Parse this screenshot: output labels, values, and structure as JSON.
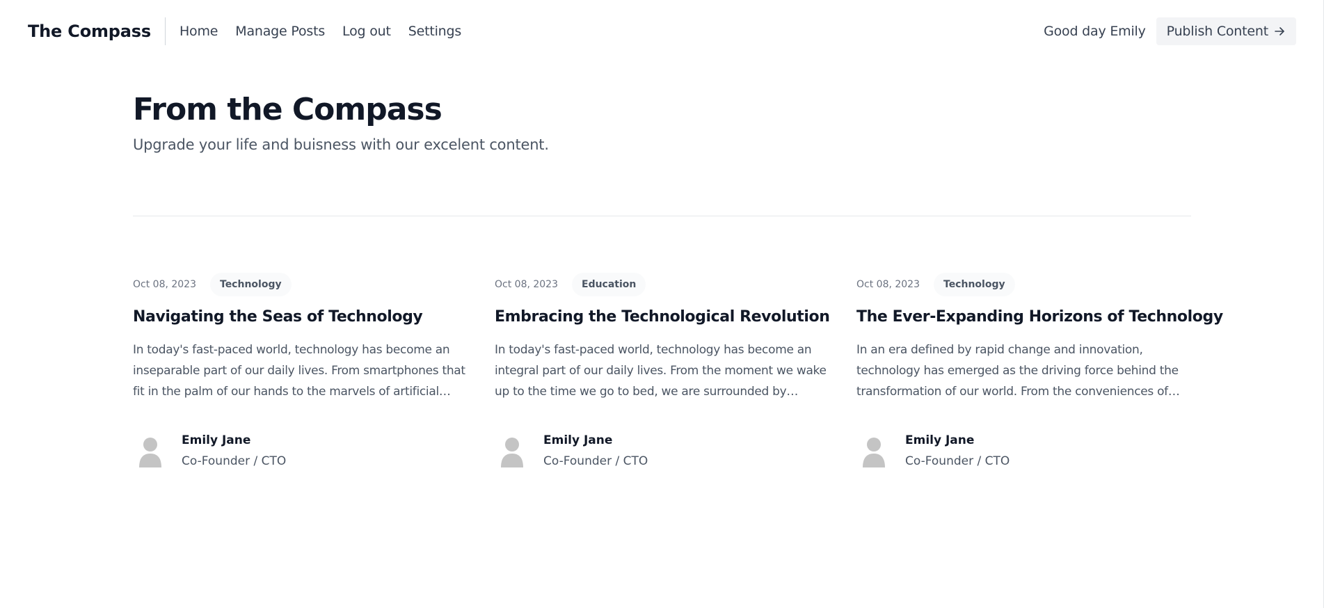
{
  "header": {
    "brand": "The Compass",
    "nav": [
      {
        "label": "Home"
      },
      {
        "label": "Manage Posts"
      },
      {
        "label": "Log out"
      },
      {
        "label": "Settings"
      }
    ],
    "greeting": "Good day Emily",
    "publish_label": "Publish Content",
    "publish_icon": "arrow-right-icon"
  },
  "hero": {
    "title": "From the Compass",
    "subtitle": "Upgrade your life and buisness with our excelent content."
  },
  "posts": [
    {
      "date": "Oct 08, 2023",
      "tag": "Technology",
      "title": "Navigating the Seas of Technology",
      "excerpt": "In today's fast-paced world, technology has become an inseparable part of our daily lives. From smartphones that fit in the palm of our hands to the marvels of artificial intelligence",
      "author": {
        "name": "Emily Jane",
        "role": "Co-Founder / CTO",
        "avatar": "user-silhouette-icon"
      }
    },
    {
      "date": "Oct 08, 2023",
      "tag": "Education",
      "title": "Embracing the Technological Revolution",
      "excerpt": "In today's fast-paced world, technology has become an integral part of our daily lives. From the moment we wake up to the time we go to bed, we are surrounded by gadgets and devices",
      "author": {
        "name": "Emily Jane",
        "role": "Co-Founder / CTO",
        "avatar": "user-silhouette-icon"
      }
    },
    {
      "date": "Oct 08, 2023",
      "tag": "Technology",
      "title": "The Ever-Expanding Horizons of Technology",
      "excerpt": "In an era defined by rapid change and innovation, technology has emerged as the driving force behind the transformation of our world. From the conveniences of everyday life",
      "author": {
        "name": "Emily Jane",
        "role": "Co-Founder / CTO",
        "avatar": "user-silhouette-icon"
      }
    }
  ],
  "colors": {
    "text_primary": "#111827",
    "text_secondary": "#4b5563",
    "muted": "#6b7280",
    "button_bg": "#f3f4f6",
    "tag_bg": "#f9fafb",
    "divider": "#e5e7eb",
    "avatar": "#c4c4c4"
  }
}
